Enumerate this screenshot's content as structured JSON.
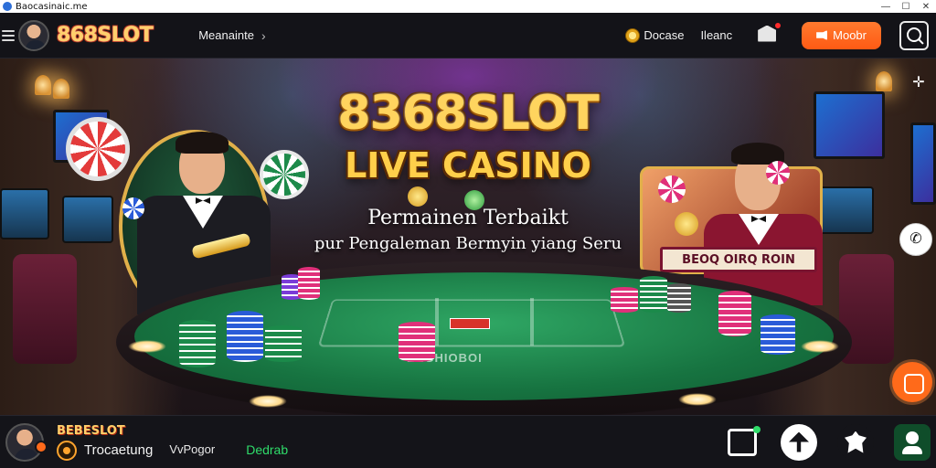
{
  "window": {
    "title": "Baocasinaic.me",
    "controls": [
      "—",
      "☐",
      "✕"
    ]
  },
  "header": {
    "brand": "868SLOT",
    "nav_link": "Meanainte",
    "nav_chevron": "›",
    "deposit_label": "Docase",
    "home_label": "Ileanc",
    "cta_label": "Moobr",
    "notification_dot": true
  },
  "hero": {
    "title_line1": "8368SLOT",
    "title_line2": "LIVE CASINO",
    "subtitle_line1": "Permainen Terbaikt",
    "subtitle_line2": "pur Pengaleman Bermyin yiang Seru",
    "plaque_text": "BEOQ OIRQ ROIN",
    "felt_text": "EEGHIOBOI"
  },
  "side": {
    "move_icon": "✛",
    "phone_icon": "✆"
  },
  "bottom_bar": {
    "brand": "BEBESLOT",
    "label": "Trocaetung",
    "link": "VvPogor",
    "green_label": "Dedrab"
  },
  "colors": {
    "accent_orange": "#ff5a14",
    "brand_gold": "#ffcf6b",
    "felt_green": "#1f8a4f",
    "status_green": "#2fdc6a"
  },
  "icons": [
    "menu-icon",
    "avatar",
    "coin-icon",
    "bell-icon",
    "cta-icon",
    "search-icon",
    "move-icon",
    "phone-icon",
    "game-icon",
    "cashier-icon",
    "gift-icon",
    "promo-icon",
    "profile-icon"
  ]
}
